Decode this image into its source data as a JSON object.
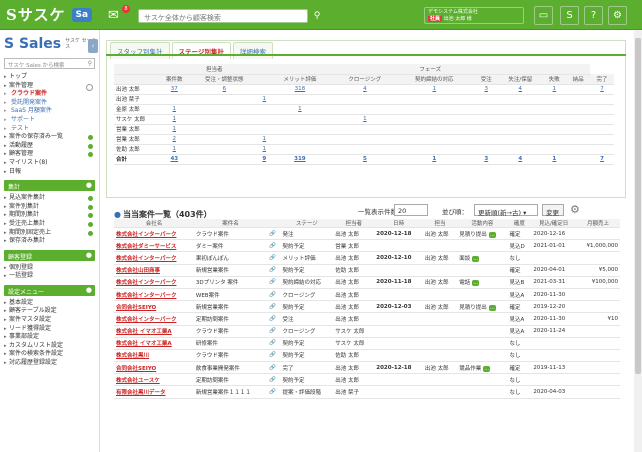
{
  "header": {
    "logo": "Sサスケ",
    "badge": "Sa",
    "search_placeholder": "サスケ全体から顧客検索",
    "notif_count": "8",
    "user_company": "デモシステム株式会社",
    "user_tag": "社員",
    "user_name": "出池 太郎 様"
  },
  "sidebar": {
    "title": "Sales",
    "title_sup": "サスケ セールス",
    "search_placeholder": "サスケ Sales から検索",
    "nav": [
      {
        "label": "トップ",
        "cls": ""
      },
      {
        "label": "案件管理",
        "cls": "gray"
      },
      {
        "label": "クラウド案件",
        "cls": "sub active"
      },
      {
        "label": "受託開発案件",
        "cls": "sub"
      },
      {
        "label": "SaaS 月額案件",
        "cls": "sub"
      },
      {
        "label": "サポート",
        "cls": "sub"
      },
      {
        "label": "テスト",
        "cls": "sub"
      },
      {
        "label": "案件の保存済み一覧",
        "cls": "green"
      },
      {
        "label": "活動履歴",
        "cls": "green"
      },
      {
        "label": "顧客管理",
        "cls": "green"
      },
      {
        "label": "マイリスト(8)",
        "cls": ""
      },
      {
        "label": "日報",
        "cls": ""
      }
    ],
    "sections": [
      {
        "title": "集計",
        "items": [
          {
            "label": "見込案件集計",
            "cls": "green"
          },
          {
            "label": "案件別集計",
            "cls": "green"
          },
          {
            "label": "期間別集計",
            "cls": "green"
          },
          {
            "label": "受注売上集計",
            "cls": "green"
          },
          {
            "label": "期間別固定売上",
            "cls": "green"
          },
          {
            "label": "保存済み集計",
            "cls": ""
          }
        ]
      },
      {
        "title": "顧客登録",
        "items": [
          {
            "label": "個別登録",
            "cls": ""
          },
          {
            "label": "一括登録",
            "cls": ""
          }
        ]
      },
      {
        "title": "設定メニュー",
        "items": [
          {
            "label": "基本設定",
            "cls": ""
          },
          {
            "label": "顧客テーブル設定",
            "cls": ""
          },
          {
            "label": "案件マスタ設定",
            "cls": ""
          },
          {
            "label": "リード獲得設定",
            "cls": ""
          },
          {
            "label": "事業部設定",
            "cls": ""
          },
          {
            "label": "カスタムリスト設定",
            "cls": ""
          },
          {
            "label": "案件の検索条件設定",
            "cls": ""
          },
          {
            "label": "対応履歴登録設定",
            "cls": ""
          }
        ]
      }
    ]
  },
  "tabs": [
    "スタッフ別集計",
    "ステージ別集計",
    "詳細検索"
  ],
  "stats": {
    "head_staff": "担当者",
    "head_phase": "フェーズ",
    "cols": [
      "案件数",
      "受注・調整状態",
      "メリット評価",
      "クロージング",
      "契約締結の対応",
      "受注",
      "失注/保留",
      "失敗",
      "納品",
      "完了"
    ],
    "rows": [
      {
        "name": "出池 太郎",
        "v": [
          "37",
          "6",
          "",
          "318",
          "",
          "4",
          "",
          "1",
          "",
          "3",
          "4",
          "1",
          "",
          "7"
        ]
      },
      {
        "name": "出池 栞子",
        "v": [
          "",
          "",
          "1",
          "",
          "",
          "",
          "",
          "",
          "",
          "",
          "",
          "",
          "",
          ""
        ]
      },
      {
        "name": "金原 太郎",
        "v": [
          "1",
          "",
          "",
          "1",
          "",
          "",
          "",
          "",
          "",
          "",
          "",
          "",
          "",
          ""
        ]
      },
      {
        "name": "サスケ 太郎",
        "v": [
          "1",
          "",
          "",
          "",
          "",
          "1",
          "",
          "",
          "",
          "",
          "",
          "",
          "",
          ""
        ]
      },
      {
        "name": "営業 太郎",
        "v": [
          "1",
          "",
          "",
          "",
          "",
          "",
          "",
          "",
          "",
          "",
          "",
          "",
          "",
          ""
        ]
      },
      {
        "name": "営業 太郎",
        "v": [
          "2",
          "",
          "1",
          "",
          "",
          "",
          "",
          "",
          "",
          "",
          "",
          "",
          "",
          ""
        ]
      },
      {
        "name": "佐助 太郎",
        "v": [
          "1",
          "",
          "1",
          "",
          "",
          "",
          "",
          "",
          "",
          "",
          "",
          "",
          "",
          ""
        ]
      },
      {
        "name": "合計",
        "v": [
          "43",
          "",
          "9",
          "319",
          "",
          "5",
          "",
          "1",
          "",
          "3",
          "4",
          "1",
          "",
          "7"
        ]
      }
    ]
  },
  "list": {
    "title": "当当案件一覧（403件）",
    "search_count_label": "一覧表示件数：",
    "search_count": "20",
    "sort_label": "並び順：",
    "sort_value": "更新順(新→古)",
    "change_label": "変更",
    "headers": [
      "会社名",
      "案件名",
      "",
      "ステージ",
      "担当者",
      "日時",
      "担当",
      "活動内容",
      "確度",
      "見込/確定日",
      "月額売上"
    ],
    "rows": [
      [
        "株式会社インターパーク",
        "クラウド案件",
        "発注",
        "出池 太郎",
        "2020-12-18",
        "出池 太郎",
        "見積り提出",
        "確定",
        "2020-12-16",
        ""
      ],
      [
        "株式会社ダミーサービス",
        "ダミー案件",
        "契約予定",
        "営業 太郎",
        "",
        "",
        "",
        "見込D",
        "2021-01-01",
        "¥1,000,000"
      ],
      [
        "株式会社インターパーク",
        "果初ぽんぽん",
        "メリット評価",
        "出池 太郎",
        "2020-12-10",
        "出池 太郎",
        "面談",
        "なし",
        "",
        ""
      ],
      [
        "株式会社山田商事",
        "新規営業案件",
        "契約予定",
        "佐助 太郎",
        "",
        "",
        "",
        "確定",
        "2020-04-01",
        "¥5,000"
      ],
      [
        "株式会社インターパーク",
        "3Dプリンタ 案件",
        "契約締結の対応",
        "出池 太郎",
        "2020-11-18",
        "出池 太郎",
        "電話",
        "見込B",
        "2021-03-31",
        "¥100,000"
      ],
      [
        "株式会社インターパーク",
        "WEB案件",
        "クロージング",
        "出池 太郎",
        "",
        "",
        "",
        "見込A",
        "2020-11-30",
        ""
      ],
      [
        "合同会社SEIYO",
        "新規営業案件",
        "契約予定",
        "出池 太郎",
        "2020-12-03",
        "出池 太郎",
        "見積り提出",
        "確定",
        "2019-12-20",
        ""
      ],
      [
        "株式会社インターパーク",
        "定期訪問案件",
        "受注",
        "出池 太郎",
        "",
        "",
        "",
        "見込A",
        "2020-11-30",
        "¥10"
      ],
      [
        "株式会社 イマオ工業A",
        "クラウド案件",
        "クロージング",
        "サスケ 太郎",
        "",
        "",
        "",
        "見込A",
        "2020-11-24",
        ""
      ],
      [
        "株式会社 イマオ工業A",
        "研修案件",
        "契約予定",
        "サスケ 太郎",
        "",
        "",
        "",
        "なし",
        "",
        ""
      ],
      [
        "株式会社黒川",
        "クラウド案件",
        "契約予定",
        "佐助 太郎",
        "",
        "",
        "",
        "なし",
        "",
        ""
      ],
      [
        "合同会社SEIYO",
        "飲食事業開発案件",
        "完了",
        "出池 太郎",
        "2020-12-18",
        "出池 太郎",
        "競品作業",
        "確定",
        "2019-11-13",
        ""
      ],
      [
        "株式会社ユースケ",
        "定期訪問案件",
        "契約予定",
        "出池 太郎",
        "",
        "",
        "",
        "なし",
        "",
        ""
      ],
      [
        "有限会社黒川データ",
        "新規営業案件１１１１",
        "提案・評価段階",
        "出池 栞子",
        "",
        "",
        "",
        "なし",
        "2020-04-03",
        ""
      ]
    ]
  }
}
